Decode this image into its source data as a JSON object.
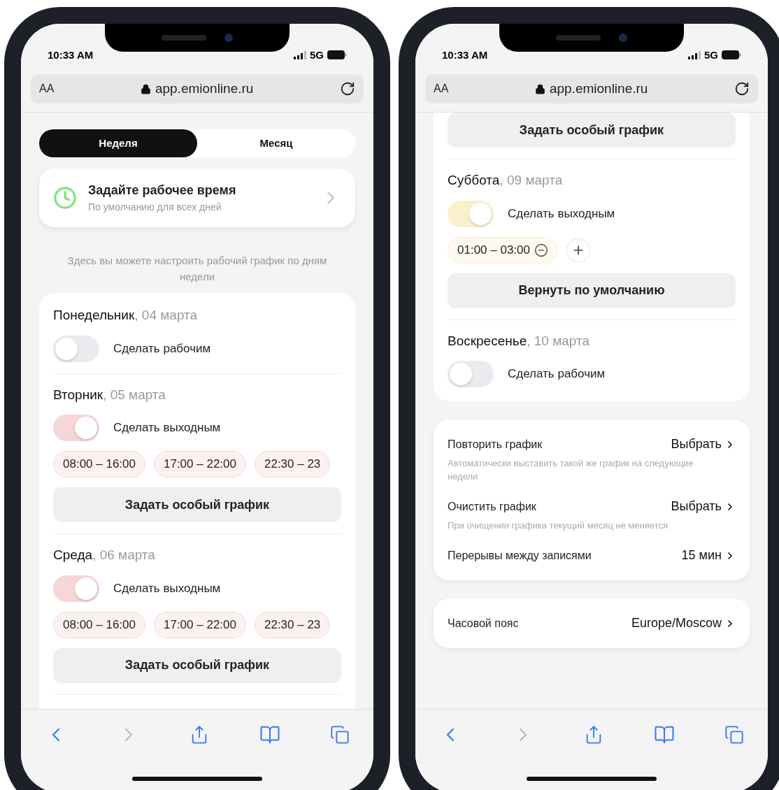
{
  "phones": [
    {
      "status_bar": {
        "time": "10:33 AM",
        "network": "5G"
      },
      "address_bar": {
        "text_size": "AA",
        "url": "app.emionline.ru"
      },
      "sections": [
        {
          "kind": "tabs",
          "tabs": [
            {
              "label": "Неделя",
              "selected": true
            },
            {
              "label": "Месяц",
              "selected": false
            }
          ]
        },
        {
          "kind": "default_time",
          "title": "Задайте рабочее время",
          "subtitle": "По умолчанию для всех дней"
        },
        {
          "kind": "hint",
          "text": "Здесь вы можете настроить рабочий график по дням недели"
        },
        {
          "kind": "days",
          "days": [
            {
              "name": "Понедельник",
              "date": ", 04 марта",
              "on": false,
              "toggle_label": "Сделать рабочим"
            },
            {
              "name": "Вторник",
              "date": ", 05 марта",
              "on": true,
              "color": "#f6d6d6",
              "toggle_label": "Сделать выходным",
              "chips": [
                {
                  "text": "08:00 – 16:00",
                  "removable": false
                },
                {
                  "text": "17:00 – 22:00",
                  "removable": false
                },
                {
                  "text": "22:30 – 23",
                  "removable": false
                }
              ],
              "button": "Задать особый график"
            },
            {
              "name": "Среда",
              "date": ", 06 марта",
              "on": true,
              "color": "#f6d6d6",
              "toggle_label": "Сделать выходным",
              "chips": [
                {
                  "text": "08:00 – 16:00",
                  "removable": false
                },
                {
                  "text": "17:00 – 22:00",
                  "removable": false
                },
                {
                  "text": "22:30 – 23",
                  "removable": false
                }
              ],
              "button": "Задать особый график"
            }
          ]
        }
      ]
    },
    {
      "status_bar": {
        "time": "10:33 AM",
        "network": "5G"
      },
      "address_bar": {
        "text_size": "AA",
        "url": "app.emionline.ru"
      },
      "sections": [
        {
          "kind": "days_continued",
          "days": [
            {
              "button": "Задать особый график"
            },
            {
              "name": "Суббота",
              "date": ", 09 марта",
              "on": true,
              "color": "#fbf0cc",
              "toggle_label": "Сделать выходным",
              "chips": [
                {
                  "text": "01:00 – 03:00",
                  "removable": true
                }
              ],
              "add_button": true,
              "button": "Вернуть по умолчанию"
            },
            {
              "name": "Воскресенье",
              "date": ", 10 марта",
              "on": false,
              "toggle_label": "Сделать рабочим"
            }
          ]
        },
        {
          "kind": "settings",
          "rows": [
            {
              "label": "Повторить график",
              "description": "Автоматически выставить такой же график на следующие недели",
              "value": "Выбрать"
            },
            {
              "label": "Очистить график",
              "description": "При очищении графика текущий месяц не меняется",
              "value": "Выбрать"
            },
            {
              "label": "Перерывы между записями",
              "value": "15 мин"
            }
          ]
        },
        {
          "kind": "settings",
          "rows": [
            {
              "label": "Часовой пояс",
              "value": "Europe/Moscow"
            }
          ]
        }
      ]
    }
  ]
}
